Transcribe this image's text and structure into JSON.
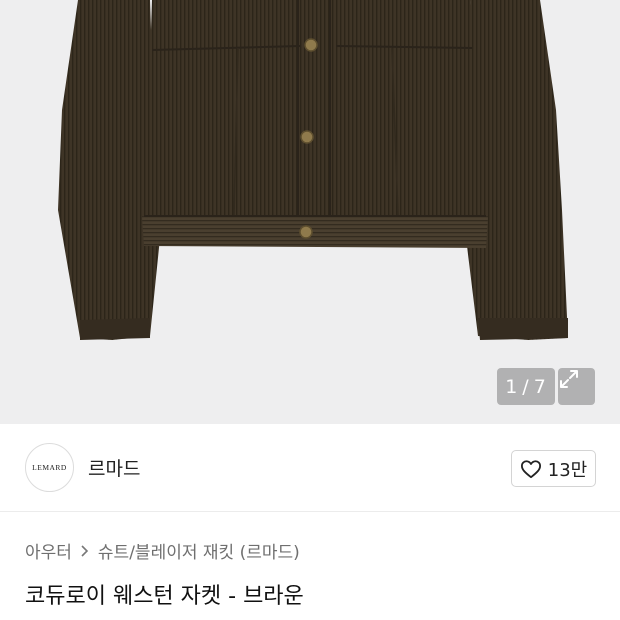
{
  "gallery": {
    "counter_current": "1",
    "counter_separator": "/",
    "counter_total": "7",
    "expand_icon": "expand-icon",
    "background_color": "#eeeeef",
    "product_color": "#3e3426"
  },
  "brand": {
    "logo_text": "LEMARD",
    "name": "르마드",
    "like_icon": "heart-icon",
    "like_count": "13만"
  },
  "breadcrumb": {
    "category": "아우터",
    "subcategory": "슈트/블레이저 재킷 (르마드)"
  },
  "product": {
    "title": "코듀로이 웨스턴 자켓 - 브라운"
  }
}
